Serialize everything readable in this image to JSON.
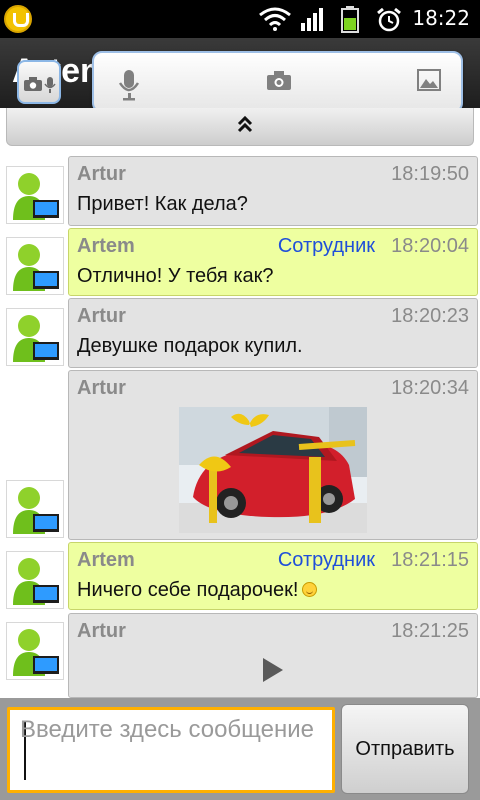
{
  "statusbar": {
    "time": "18:22",
    "icons": [
      "app-logo-icon",
      "wifi-icon",
      "signal-icon",
      "battery-icon",
      "alarm-icon"
    ]
  },
  "header": {
    "title": "Artem"
  },
  "attach_popup": {
    "items": [
      "microphone-icon",
      "camera-icon",
      "gallery-icon"
    ]
  },
  "collapse_bar": {
    "icon": "double-chevron-up-icon"
  },
  "messages": [
    {
      "sender": "Artur",
      "time": "18:19:50",
      "text": "Привет! Как дела?",
      "style": "incoming"
    },
    {
      "sender": "Artem",
      "role": "Сотрудник",
      "time": "18:20:04",
      "text": "Отлично! У тебя как?",
      "style": "outgoing"
    },
    {
      "sender": "Artur",
      "time": "18:20:23",
      "text": "Девушке подарок купил.",
      "style": "incoming"
    },
    {
      "sender": "Artur",
      "time": "18:20:34",
      "attachment": "photo of red car with gold gift bow",
      "style": "incoming"
    },
    {
      "sender": "Artem",
      "role": "Сотрудник",
      "time": "18:21:15",
      "text": "Ничего себе подарочек!",
      "emoji": "smiley-icon",
      "style": "outgoing"
    },
    {
      "sender": "Artur",
      "time": "18:21:25",
      "attachment": "play-icon",
      "style": "incoming"
    }
  ],
  "composer": {
    "placeholder": "Введите здесь сообщение",
    "value": "",
    "send_label": "Отправить"
  },
  "colors": {
    "outgoing_bubble": "#eeffa0",
    "incoming_bubble": "#e3e3e3",
    "role_text": "#1f4fd9",
    "input_focus": "#ffb000"
  }
}
